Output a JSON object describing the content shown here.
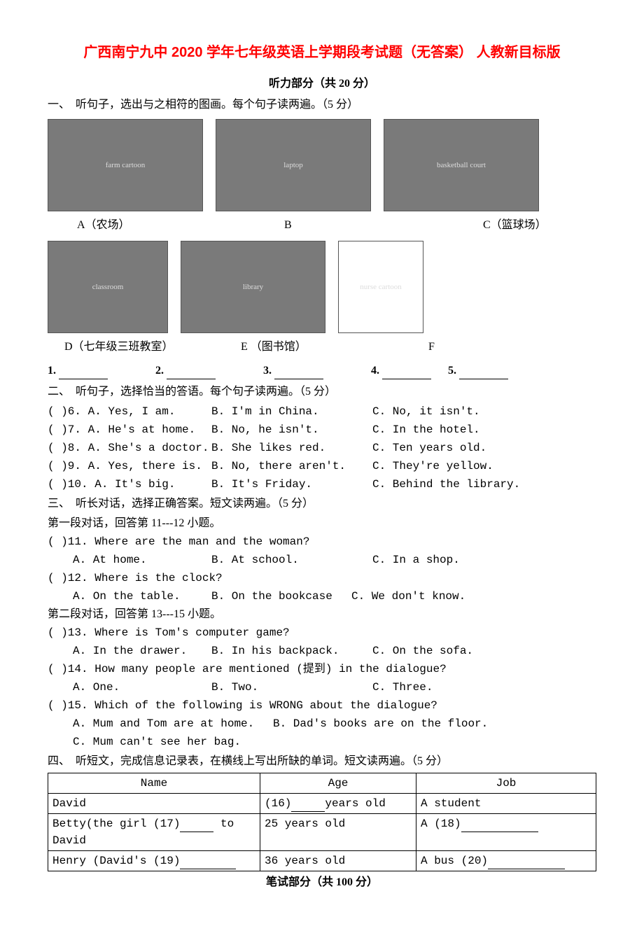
{
  "title": "广西南宁九中 2020 学年七年级英语上学期段考试题（无答案） 人教新目标版",
  "listening_header": "听力部分（共 20 分）",
  "section1": "一、　听句子，选出与之相符的图画。每个句子读两遍。（5 分）",
  "img_labels": {
    "a": "A（农场）",
    "b": "B",
    "c": "C（篮球场）",
    "d": "D（七年级三班教室）",
    "e": "E （图书馆）",
    "f": "F"
  },
  "img_alts": {
    "a": "farm cartoon",
    "b": "laptop",
    "c": "basketball court",
    "d": "classroom",
    "e": "library",
    "f": "nurse cartoon"
  },
  "blanks_numbers": [
    "1.",
    "2.",
    "3.",
    "4.",
    "5."
  ],
  "section2": "二、　听句子，选择恰当的答语。每个句子读两遍。（5 分）",
  "q6": {
    "n": "(  )6.",
    "a": "A. Yes, I am.",
    "b": "B. I'm in China.",
    "c": "C. No, it isn't."
  },
  "q7": {
    "n": "(  )7.",
    "a": "A. He's at home.",
    "b": "B. No, he isn't.",
    "c": "C. In the hotel."
  },
  "q8": {
    "n": "(  )8.",
    "a": "A. She's a doctor.",
    "b": "B. She likes red.",
    "c": "C. Ten years old."
  },
  "q9": {
    "n": "(  )9.",
    "a": "A. Yes, there is.",
    "b": "B. No, there aren't.",
    "c": "C. They're yellow."
  },
  "q10": {
    "n": "(  )10.",
    "a": "A. It's big.",
    "b": "B. It's Friday.",
    "c": "C. Behind the library."
  },
  "section3": "三、　听长对话，选择正确答案。短文读两遍。（5 分）",
  "dialog1": "第一段对话，回答第 11---12 小题。",
  "q11": {
    "n": "(  )11. Where are the man and the woman?",
    "a": "A. At home.",
    "b": "B. At school.",
    "c": "C. In a shop."
  },
  "q12": {
    "n": "(  )12. Where is the clock?",
    "a": "A. On the table.",
    "b": "B. On the bookcase",
    "c": "C. We don't know."
  },
  "dialog2": "第二段对话，回答第 13---15 小题。",
  "q13": {
    "n": "(  )13. Where is Tom's computer game?",
    "a": "A. In the drawer.",
    "b": "B. In his backpack.",
    "c": "C. On the sofa."
  },
  "q14": {
    "n": "(  )14. How many people are mentioned (提到) in the dialogue?",
    "a": "A. One.",
    "b": "B. Two.",
    "c": "C. Three."
  },
  "q15": {
    "n": "(  )15. Which of the following is WRONG about the dialogue?",
    "a": "A. Mum and Tom are at home.",
    "b": "B. Dad's books are on the floor.",
    "c": "C. Mum can't see her bag."
  },
  "section4": "四、　听短文，完成信息记录表，在横线上写出所缺的单词。短文读两遍。（5 分）",
  "table": {
    "headers": {
      "name": "Name",
      "age": "Age",
      "job": "Job"
    },
    "row1": {
      "name": "David",
      "age_pre": "(16)",
      "age_post": "years old",
      "job": "A student"
    },
    "row2": {
      "name_pre": "Betty(the girl (17)",
      "name_post": " to David",
      "age": "25 years old",
      "job_pre": "A (18)"
    },
    "row3": {
      "name_pre": "Henry (David's (19)",
      "age": "36 years old",
      "job_pre": "A bus (20)"
    }
  },
  "written_header": "笔试部分（共 100 分）"
}
